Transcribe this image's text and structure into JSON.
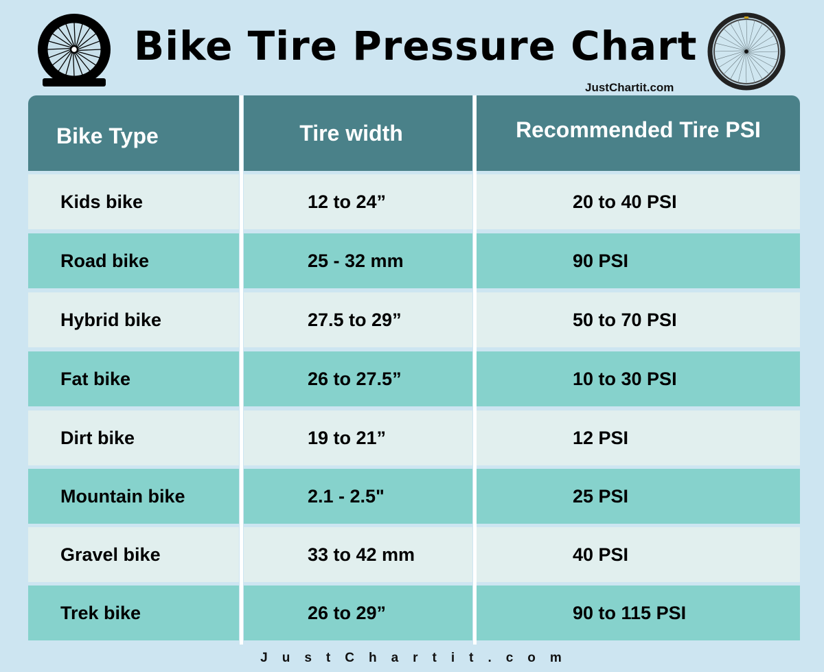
{
  "header": {
    "title": "Bike Tire Pressure Chart",
    "brand_top": "JustChartit.com",
    "left_icon": "flat-bike-wheel-icon",
    "right_icon": "bike-wheel-photo-icon"
  },
  "table": {
    "columns": [
      "Bike Type",
      "Tire width",
      "Recommended Tire PSI"
    ],
    "rows": [
      {
        "bike_type": "Kids bike",
        "tire_width": "12 to 24”",
        "psi": "20 to 40 PSI"
      },
      {
        "bike_type": "Road bike",
        "tire_width": "25 - 32 mm",
        "psi": "90 PSI"
      },
      {
        "bike_type": "Hybrid bike",
        "tire_width": "27.5 to 29”",
        "psi": "50 to 70 PSI"
      },
      {
        "bike_type": "Fat bike",
        "tire_width": "26 to 27.5”",
        "psi": "10 to 30 PSI"
      },
      {
        "bike_type": "Dirt bike",
        "tire_width": "19 to 21”",
        "psi": "12 PSI"
      },
      {
        "bike_type": "Mountain bike",
        "tire_width": "2.1 - 2.5\"",
        "psi": "25 PSI"
      },
      {
        "bike_type": "Gravel bike",
        "tire_width": "33 to 42 mm",
        "psi": "40 PSI"
      },
      {
        "bike_type": "Trek bike",
        "tire_width": "26 to 29”",
        "psi": "90 to 115 PSI"
      }
    ]
  },
  "footer": {
    "brand_bottom": "JustChartit.com"
  },
  "colors": {
    "background": "#cde5f1",
    "header": "#4a8189",
    "row_light": "#e1efee",
    "row_dark": "#86d2cc"
  }
}
